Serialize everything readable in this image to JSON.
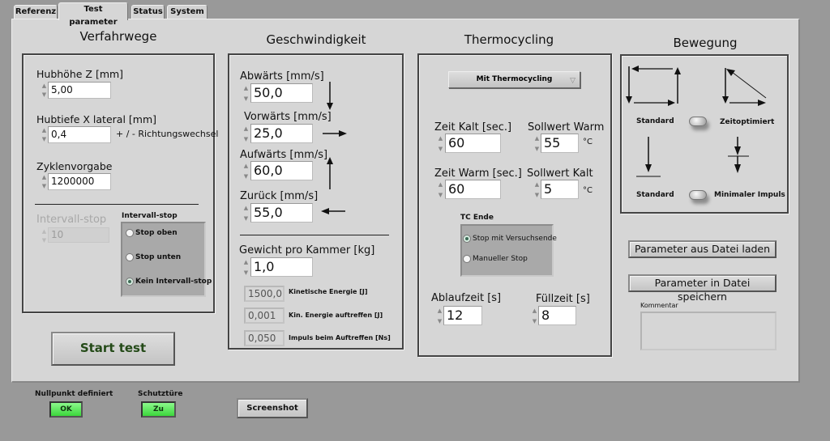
{
  "tabs": [
    {
      "label": "Referenz",
      "active": false
    },
    {
      "label": "Test parameter",
      "active": true
    },
    {
      "label": "Status",
      "active": false
    },
    {
      "label": "System",
      "active": false
    }
  ],
  "verfahrwege": {
    "title": "Verfahrwege",
    "hubhoehe": {
      "label": "Hubhöhe Z [mm]",
      "value": "5,00"
    },
    "hubtiefe": {
      "label": "Hubtiefe X lateral [mm]",
      "value": "0,4",
      "note": "+ / - Richtungswechsel"
    },
    "zyklen": {
      "label": "Zyklenvorgabe",
      "value": "1200000"
    },
    "intervall_stop_num": {
      "label": "Intervall-stop",
      "value": "10",
      "disabled": true
    },
    "intervall_stop_group": {
      "label": "Intervall-stop",
      "options": [
        "Stop oben",
        "Stop unten",
        "Kein Intervall-stop"
      ],
      "selected": "Kein Intervall-stop"
    }
  },
  "start_button": "Start test",
  "geschwindigkeit": {
    "title": "Geschwindigkeit",
    "abwaerts": {
      "label": "Abwärts [mm/s]",
      "value": "50,0"
    },
    "vorwaerts": {
      "label": "Vorwärts [mm/s]",
      "value": "25,0"
    },
    "aufwaerts": {
      "label": "Aufwärts [mm/s]",
      "value": "60,0"
    },
    "zurueck": {
      "label": "Zurück [mm/s]",
      "value": "55,0"
    },
    "gewicht": {
      "label": "Gewicht pro Kammer [kg]",
      "value": "1,0"
    },
    "kin_energie": {
      "label": "Kinetische Energie [J]",
      "value": "1500,0"
    },
    "kin_energie_auftreffen": {
      "label": "Kin. Energie auftreffen [J]",
      "value": "0,001"
    },
    "impuls": {
      "label": "Impuls beim Auftreffen [Ns]",
      "value": "0,050"
    }
  },
  "thermocycling": {
    "title": "Thermocycling",
    "mode": "Mit Thermocycling",
    "zeit_kalt": {
      "label": "Zeit Kalt [sec.]",
      "value": "60"
    },
    "sollwert_warm": {
      "label": "Sollwert Warm",
      "value": "55",
      "unit": "°C"
    },
    "zeit_warm": {
      "label": "Zeit Warm [sec.]",
      "value": "60"
    },
    "sollwert_kalt": {
      "label": "Sollwert Kalt",
      "value": "5",
      "unit": "°C"
    },
    "tc_ende": {
      "label": "TC Ende",
      "options": [
        "Stop mit Versuchsende",
        "Manueller Stop"
      ],
      "selected": "Stop mit Versuchsende"
    },
    "ablaufzeit": {
      "label": "Ablaufzeit [s]",
      "value": "12"
    },
    "fuellzeit": {
      "label": "Füllzeit [s]",
      "value": "8"
    }
  },
  "bewegung": {
    "title": "Bewegung",
    "switch1": {
      "left": "Standard",
      "right": "Zeitoptimiert",
      "state": "left"
    },
    "switch2": {
      "left": "Standard",
      "right": "Minimaler Impuls",
      "state": "left"
    }
  },
  "buttons": {
    "load": "Parameter aus Datei laden",
    "save": "Parameter in Datei speichern",
    "screenshot": "Screenshot"
  },
  "kommentar": {
    "label": "Kommentar",
    "value": ""
  },
  "status": {
    "nullpunkt": {
      "label": "Nullpunkt definiert",
      "value": "OK",
      "color": "#5be85b"
    },
    "schutztuere": {
      "label": "Schutztüre",
      "value": "Zu",
      "color": "#5be85b"
    }
  }
}
